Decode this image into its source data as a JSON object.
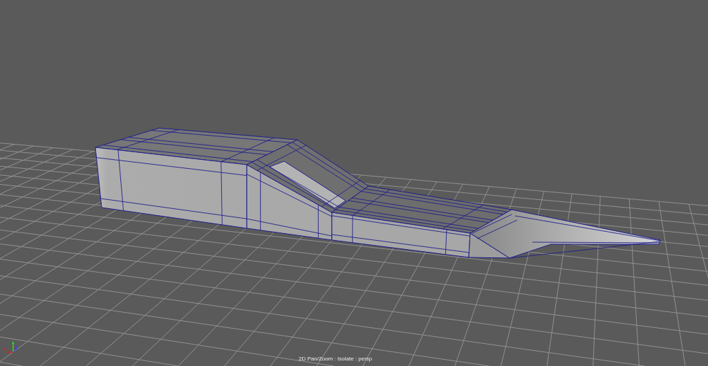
{
  "viewport": {
    "camera_label": "2D Pan/Zoom : Isolate : persp"
  }
}
